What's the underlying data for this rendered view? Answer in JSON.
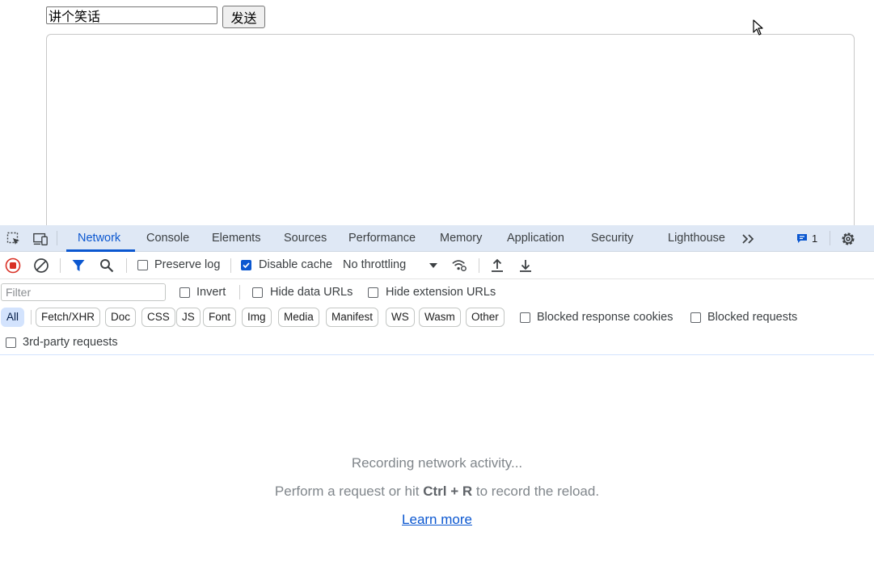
{
  "page": {
    "input_value": "讲个笑话",
    "send_label": "发送"
  },
  "devtools": {
    "tabs": [
      "Network",
      "Console",
      "Elements",
      "Sources",
      "Performance",
      "Memory",
      "Application",
      "Security",
      "Lighthouse"
    ],
    "active_tab": "Network",
    "issues_count": "1",
    "toolbar": {
      "preserve_log": "Preserve log",
      "disable_cache": "Disable cache",
      "throttling": "No throttling"
    },
    "filter": {
      "placeholder": "Filter",
      "invert": "Invert",
      "hide_data_urls": "Hide data URLs",
      "hide_extension_urls": "Hide extension URLs",
      "types": [
        "All",
        "Fetch/XHR",
        "Doc",
        "CSS",
        "JS",
        "Font",
        "Img",
        "Media",
        "Manifest",
        "WS",
        "Wasm",
        "Other"
      ],
      "blocked_response_cookies": "Blocked response cookies",
      "blocked_requests": "Blocked requests",
      "third_party": "3rd-party requests"
    },
    "empty": {
      "recording": "Recording network activity...",
      "hint_prefix": "Perform a request or hit",
      "hint_key": "Ctrl + R",
      "hint_suffix": "to record the reload.",
      "learn_more": "Learn more"
    }
  },
  "colors": {
    "accent": "#0b57d0",
    "record": "#d93025",
    "tabbar_bg": "#dfe8f5"
  },
  "icons": [
    "inspect-element-icon",
    "device-toolbar-icon",
    "more-tabs-icon",
    "issues-icon",
    "settings-gear-icon",
    "stop-recording-icon",
    "clear-icon",
    "filter-icon",
    "search-icon",
    "dropdown-arrow-icon",
    "network-conditions-icon",
    "import-har-icon",
    "export-har-icon",
    "mouse-cursor-icon"
  ]
}
